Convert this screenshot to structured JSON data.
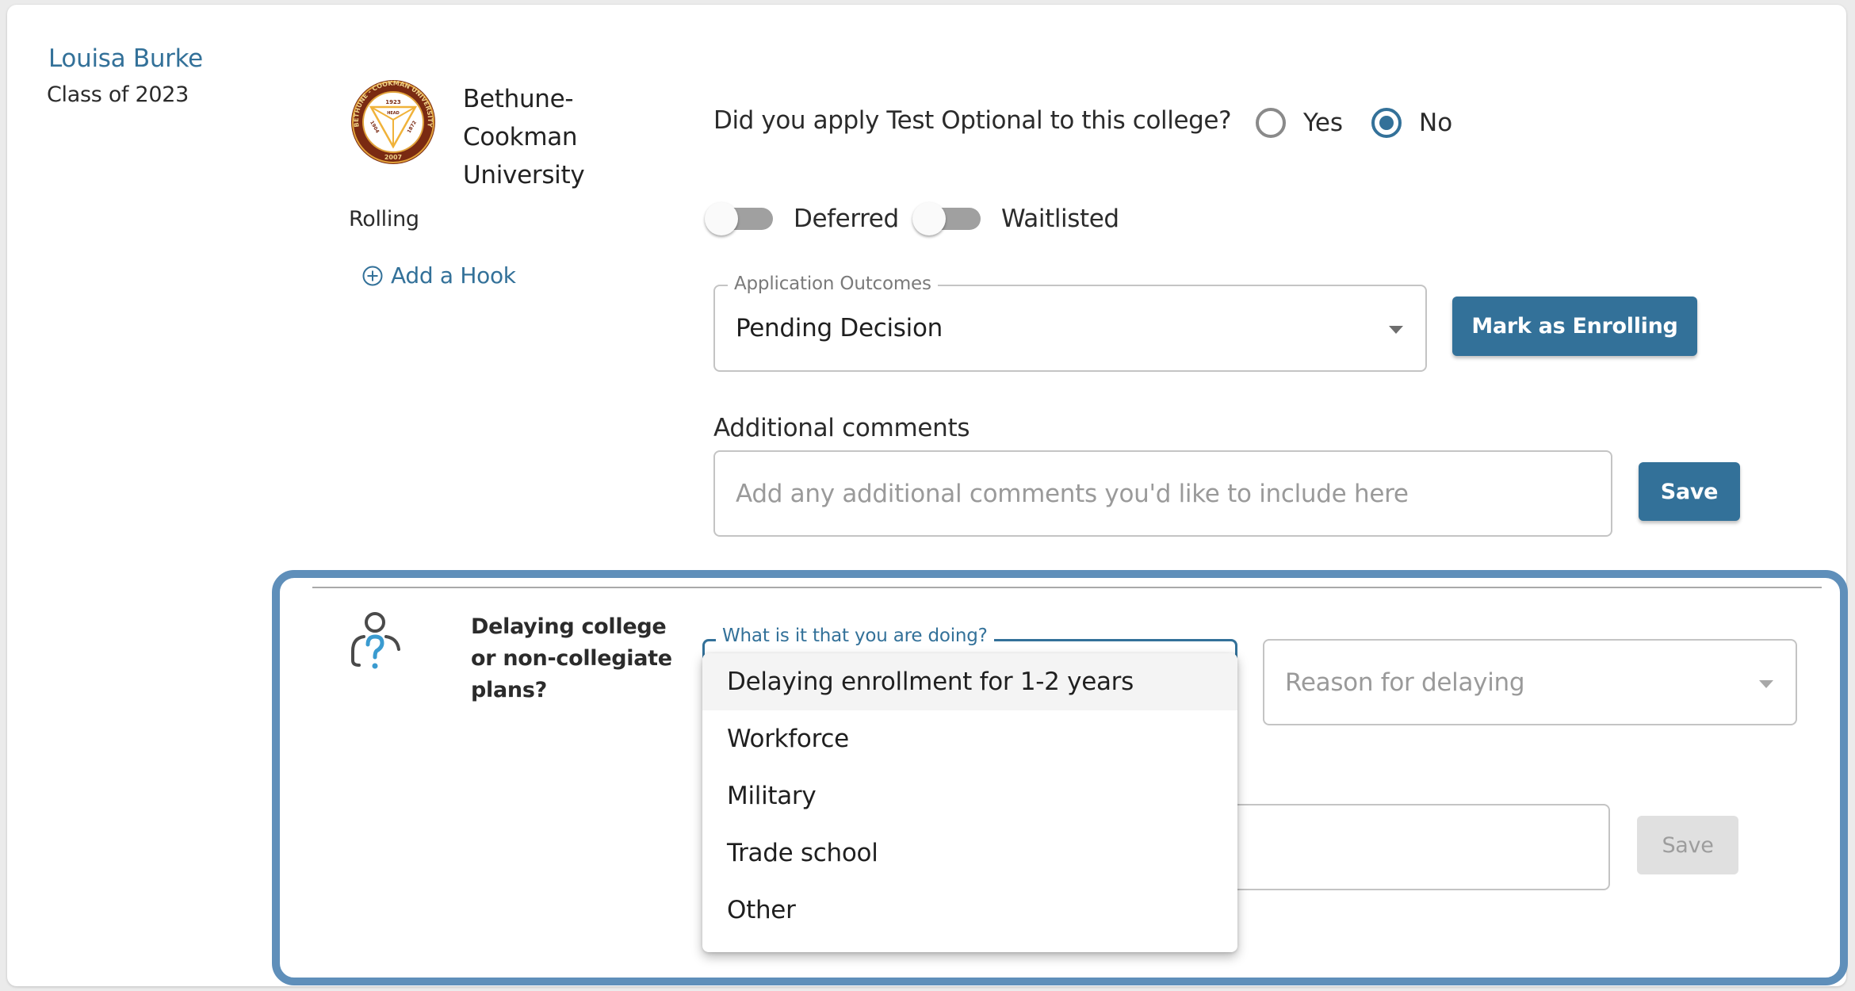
{
  "student": {
    "name": "Louisa Burke",
    "class_year": "Class of 2023"
  },
  "college": {
    "name": "Bethune-Cookman University",
    "name_lines": [
      "Bethune-",
      "Cookman",
      "University"
    ],
    "logo_icon": "college-seal-icon",
    "logo_text": {
      "ring": "BETHUNE - COOKMAN UNIVERSITY",
      "top_year": "1923",
      "center": "HEAD",
      "left": "1904",
      "right": "1872",
      "bottom_year": "2007"
    },
    "deadline_type": "Rolling",
    "add_hook_label": "Add a Hook",
    "add_hook_icon": "plus-circle-icon"
  },
  "test_optional": {
    "question": "Did you apply Test Optional to this college?",
    "options": [
      {
        "label": "Yes",
        "checked": false
      },
      {
        "label": "No",
        "checked": true
      }
    ]
  },
  "toggles": [
    {
      "label": "Deferred",
      "on": false
    },
    {
      "label": "Waitlisted",
      "on": false
    }
  ],
  "outcomes": {
    "label": "Application Outcomes",
    "value": "Pending Decision",
    "mark_enrolling_label": "Mark as Enrolling"
  },
  "comments": {
    "label": "Additional comments",
    "placeholder": "Add any additional comments you'd like to include here",
    "value": "",
    "save_label": "Save"
  },
  "plans": {
    "icon": "person-question-icon",
    "title": "Delaying college or non-collegiate plans?",
    "doing_label": "What is it that you are doing?",
    "doing_options": [
      "Delaying enrollment for 1-2 years",
      "Workforce",
      "Military",
      "Trade school",
      "Other"
    ],
    "highlighted_option_index": 0,
    "reason_placeholder": "Reason for delaying",
    "notes_value": "",
    "save_label": "Save",
    "save_disabled": true
  },
  "colors": {
    "accent": "#337199",
    "highlight_border": "#5f8fba",
    "disabled_button": "#e0e0e0"
  }
}
